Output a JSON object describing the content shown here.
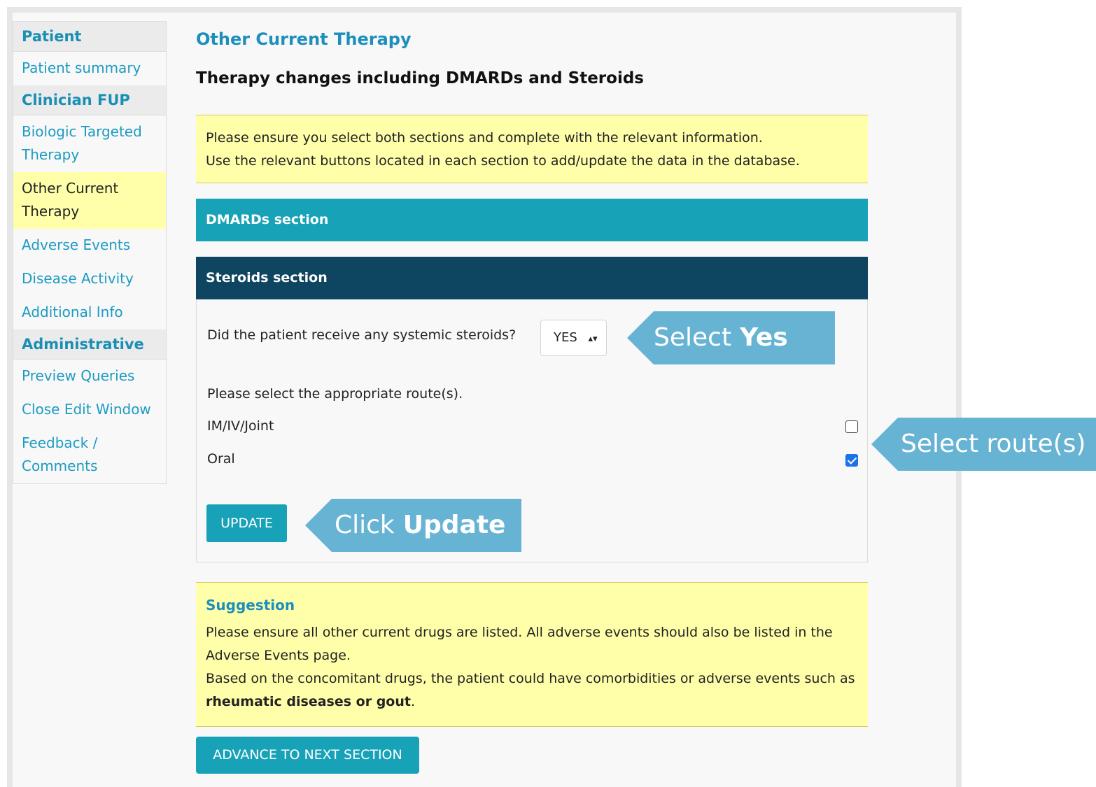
{
  "sidebar": {
    "patient_heading": "Patient",
    "patient_summary": "Patient summary",
    "clinician_heading": "Clinician FUP",
    "items": [
      {
        "label": "Biologic Targeted Therapy"
      },
      {
        "label": "Other Current Therapy"
      },
      {
        "label": "Adverse Events"
      },
      {
        "label": "Disease Activity"
      },
      {
        "label": "Additional Info"
      }
    ],
    "admin_heading": "Administrative",
    "admin_items": [
      {
        "label": "Preview Queries"
      },
      {
        "label": "Close Edit Window"
      },
      {
        "label": "Feedback / Comments"
      }
    ]
  },
  "main": {
    "title": "Other Current Therapy",
    "subtitle": "Therapy changes including DMARDs and Steroids",
    "notice_line1": "Please ensure you select both sections and complete with the relevant information.",
    "notice_line2": "Use the relevant buttons located in each section to add/update the data in the database.",
    "dmards_section": "DMARDs section",
    "steroids_section": "Steroids section",
    "steroid_question": "Did the patient receive any systemic steroids?",
    "steroid_select_value": "YES",
    "route_prompt": "Please select the appropriate route(s).",
    "routes": [
      {
        "label": "IM/IV/Joint",
        "checked": false
      },
      {
        "label": "Oral",
        "checked": true
      }
    ],
    "update_button": "UPDATE",
    "suggestion_title": "Suggestion",
    "suggestion_line1": "Please ensure all other current drugs are listed. All adverse events should also be listed in the Adverse Events page.",
    "suggestion_line2_prefix": "Based on the concomitant drugs, the patient could have comorbidities or adverse events such as ",
    "suggestion_line2_bold": "rheumatic diseases or gout",
    "suggestion_line2_suffix": ".",
    "advance_button": "ADVANCE TO NEXT SECTION"
  },
  "callouts": {
    "yes_prefix": "Select",
    "yes_bold": "Yes",
    "route": "Select route(s)",
    "update_prefix": "Click",
    "update_bold": "Update"
  },
  "colors": {
    "accent": "#17a2b8",
    "dark_header": "#0e4560",
    "highlight": "#ffffaa",
    "callout": "#66b3d4",
    "link": "#1c9bc2"
  }
}
